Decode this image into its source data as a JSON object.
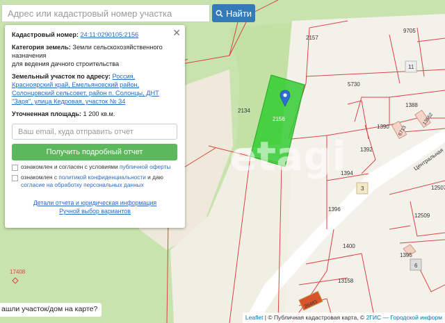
{
  "search": {
    "placeholder": "Адрес или кадастровый номер участка",
    "button_label": "Найти"
  },
  "panel": {
    "cadastral_label": "Кадастровый номер:",
    "cadastral_value": "24:11:0290105:2156",
    "category_label": "Категория земель:",
    "category_value": "Земли сельскохозяйственного назначения",
    "category_use": "для ведения дачного строительства",
    "address_label": "Земельный участок по адресу:",
    "address_value": "Россия, Красноярский край, Емельяновский район, Солонцовский сельсовет, район п. Солонцы, ДНТ \"Заря\", улица Кедровая, участок № 34",
    "area_label": "Уточненная площадь:",
    "area_value": "1 200 кв.м.",
    "email_placeholder": "Ваш email, куда отправить отчет",
    "report_button": "Получить подробный отчет",
    "consent1_prefix": "ознакомлен и согласен с условиями",
    "consent1_link": "публичной оферты",
    "consent2_prefix": "ознакомлен с",
    "consent2_link": "политикой конфиденциальности",
    "consent2_mid": "и даю",
    "consent2_link2": "согласие на обработку персональных данных",
    "link_details": "Детали отчета и юридическая информация",
    "link_manual": "Ручной выбор вариантов"
  },
  "map_labels": {
    "l2157": "2157",
    "l9705": "9705",
    "l11": "11",
    "l5730": "5730",
    "l1388": "1388",
    "l2134": "2134",
    "l2156": "2156",
    "l1390": "1390",
    "l6713": "6713",
    "l13552": "13552",
    "l1392": "1392",
    "l1394": "1394",
    "l3": "3",
    "l12507": "12507",
    "l1396": "1396",
    "l12509": "12509",
    "l1400": "1400",
    "l1395": "1395",
    "l6": "6",
    "l17408": "17408",
    "l13158": "13158",
    "l26483": "26483",
    "street": "Центральная"
  },
  "watermark": "etagi",
  "bottom_question": "ашли участок/дом на карте?",
  "attribution": {
    "leaflet": "Leaflet",
    "sep1": " | © ",
    "pkk": "Публичная кадастровая карта",
    "sep2": ", © ",
    "gis": "2ГИС — Городской информ"
  },
  "colors": {
    "selected_parcel": "#33cc33",
    "parcel_line": "#d94545",
    "search_button": "#337ab7",
    "report_button": "#5cb85c"
  }
}
